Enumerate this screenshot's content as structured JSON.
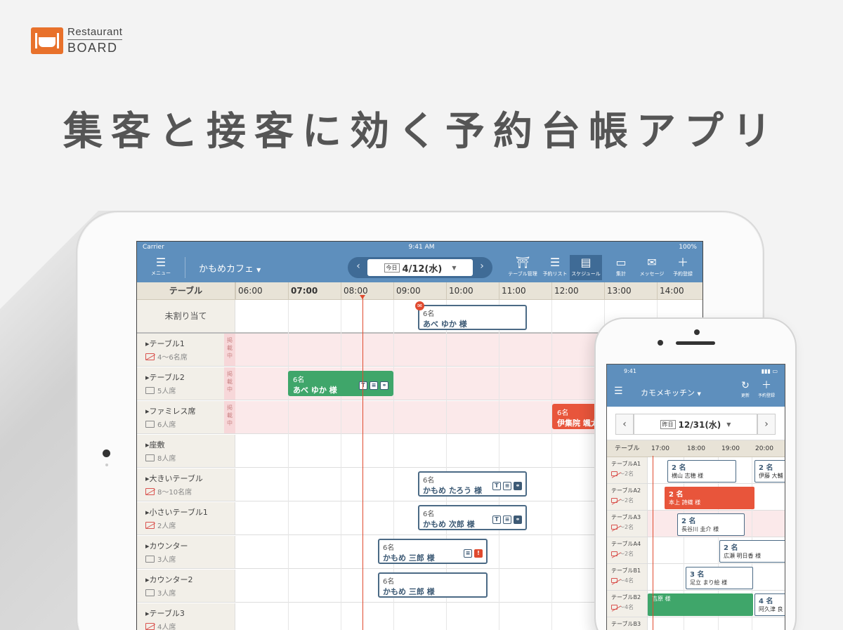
{
  "logo": {
    "line1": "Restaurant",
    "line2": "BOARD"
  },
  "headline": "集客と接客に効く予約台帳アプリ",
  "ipad": {
    "status": {
      "carrier": "Carrier",
      "time": "9:41 AM",
      "battery": "100%"
    },
    "menu_label": "メニュー",
    "store_name": "かもめカフェ",
    "date": {
      "today_tag": "今日",
      "value": "4/12(水)"
    },
    "tools": [
      {
        "label": "テーブル管理",
        "icon": "torii-icon"
      },
      {
        "label": "予約リスト",
        "icon": "list-icon"
      },
      {
        "label": "スケジュール",
        "icon": "schedule-icon",
        "active": true
      },
      {
        "label": "集計",
        "icon": "monitor-icon"
      },
      {
        "label": "メッセージ",
        "icon": "mail-icon"
      },
      {
        "label": "予約登録",
        "icon": "plus-icon"
      }
    ],
    "table_header": "テーブル",
    "times": [
      "06:00",
      "07:00",
      "08:00",
      "09:00",
      "10:00",
      "11:00",
      "12:00",
      "13:00",
      "14:00"
    ],
    "unassigned_label": "未割り当て",
    "blocked_tag": "掲載中",
    "rows": [
      {
        "name": "テーブル1",
        "seats": "4〜6名席",
        "blocked": true,
        "ng": true
      },
      {
        "name": "テーブル2",
        "seats": "5人席",
        "blocked": true,
        "ng": false
      },
      {
        "name": "ファミレス席",
        "seats": "6人席",
        "blocked": true,
        "ng": false
      },
      {
        "name": "座敷",
        "seats": "8人席",
        "blocked": false,
        "ng": false
      },
      {
        "name": "大きいテーブル",
        "seats": "8〜10名席",
        "blocked": false,
        "ng": true
      },
      {
        "name": "小さいテーブル1",
        "seats": "2人席",
        "blocked": false,
        "ng": true
      },
      {
        "name": "カウンター",
        "seats": "3人席",
        "blocked": false,
        "ng": false
      },
      {
        "name": "カウンター2",
        "seats": "3人席",
        "blocked": false,
        "ng": false
      },
      {
        "name": "テーブル3",
        "seats": "4人席",
        "blocked": false,
        "ng": true
      }
    ],
    "reservations": [
      {
        "count": "6名",
        "name": "あべ ゆか 様"
      },
      {
        "count": "6名",
        "name": "あべ ゆか 様"
      },
      {
        "count": "6名",
        "name": "伊集院 颯太"
      },
      {
        "count": "6名",
        "name": "かもめ たろう 様"
      },
      {
        "count": "6名",
        "name": "かもめ 次郎 様"
      },
      {
        "count": "6名",
        "name": "かもめ 三郎 様"
      },
      {
        "count": "6名",
        "name": "かもめ 三郎 様"
      }
    ]
  },
  "iphone": {
    "status": {
      "time": "9:41"
    },
    "store_name": "カモメキッチン",
    "tools": [
      {
        "label": "更新",
        "icon": "refresh-icon"
      },
      {
        "label": "予約登録",
        "icon": "plus-icon"
      }
    ],
    "date": {
      "tag": "昨日",
      "value": "12/31(水)"
    },
    "table_header": "テーブル",
    "times": [
      "17:00",
      "18:00",
      "19:00",
      "20:00"
    ],
    "rows": [
      {
        "name": "テーブルA1",
        "seats": "〜2名"
      },
      {
        "name": "テーブルA2",
        "seats": "〜2名"
      },
      {
        "name": "テーブルA3",
        "seats": "〜2名"
      },
      {
        "name": "テーブルA4",
        "seats": "〜2名"
      },
      {
        "name": "テーブルB1",
        "seats": "〜4名"
      },
      {
        "name": "テーブルB2",
        "seats": "〜4名"
      },
      {
        "name": "テーブルB3",
        "seats": ""
      }
    ],
    "reservations": [
      {
        "count": "2 名",
        "name": "横山 志穂 様"
      },
      {
        "count": "2 名",
        "name": "伊藤 大輔"
      },
      {
        "count": "2 名",
        "name": "本上 詩織 様"
      },
      {
        "count": "2 名",
        "name": "長谷川 圭介 様"
      },
      {
        "count": "2 名",
        "name": "広瀬 明日香 様"
      },
      {
        "count": "3 名",
        "name": "足立 まり絵 様"
      },
      {
        "count": "",
        "name": "吉原 様"
      },
      {
        "count": "4 名",
        "name": "阿久津 良"
      }
    ]
  }
}
